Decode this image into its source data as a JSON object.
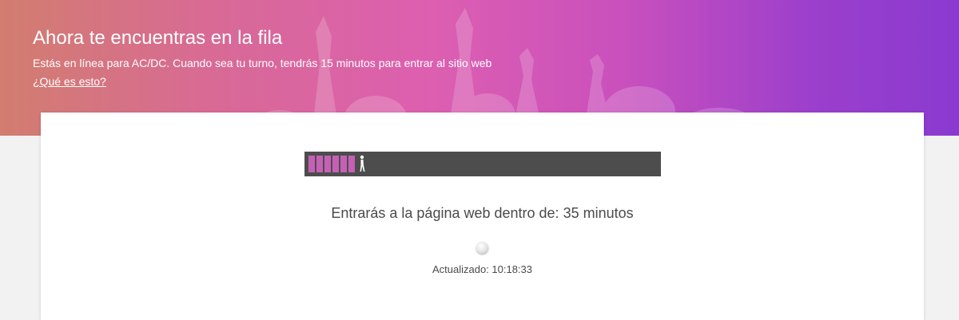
{
  "header": {
    "title": "Ahora te encuentras en la fila",
    "subtitle": "Estás en línea para AC/DC. Cuando sea tu turno, tendrás 15 minutos para entrar al sitio web",
    "help_link": "¿Qué es esto?"
  },
  "queue": {
    "progress_fraction": 0.18,
    "wait_message": "Entrarás a la página web dentro de: 35 minutos",
    "updated_text": "Actualizado: 10:18:33"
  },
  "colors": {
    "progress_track": "#4d4d4d",
    "progress_fill": "#c560b4",
    "text": "#4a4a4a"
  },
  "icons": {
    "queue_person": "walking-person-icon",
    "loading": "loading-spinner-icon"
  }
}
